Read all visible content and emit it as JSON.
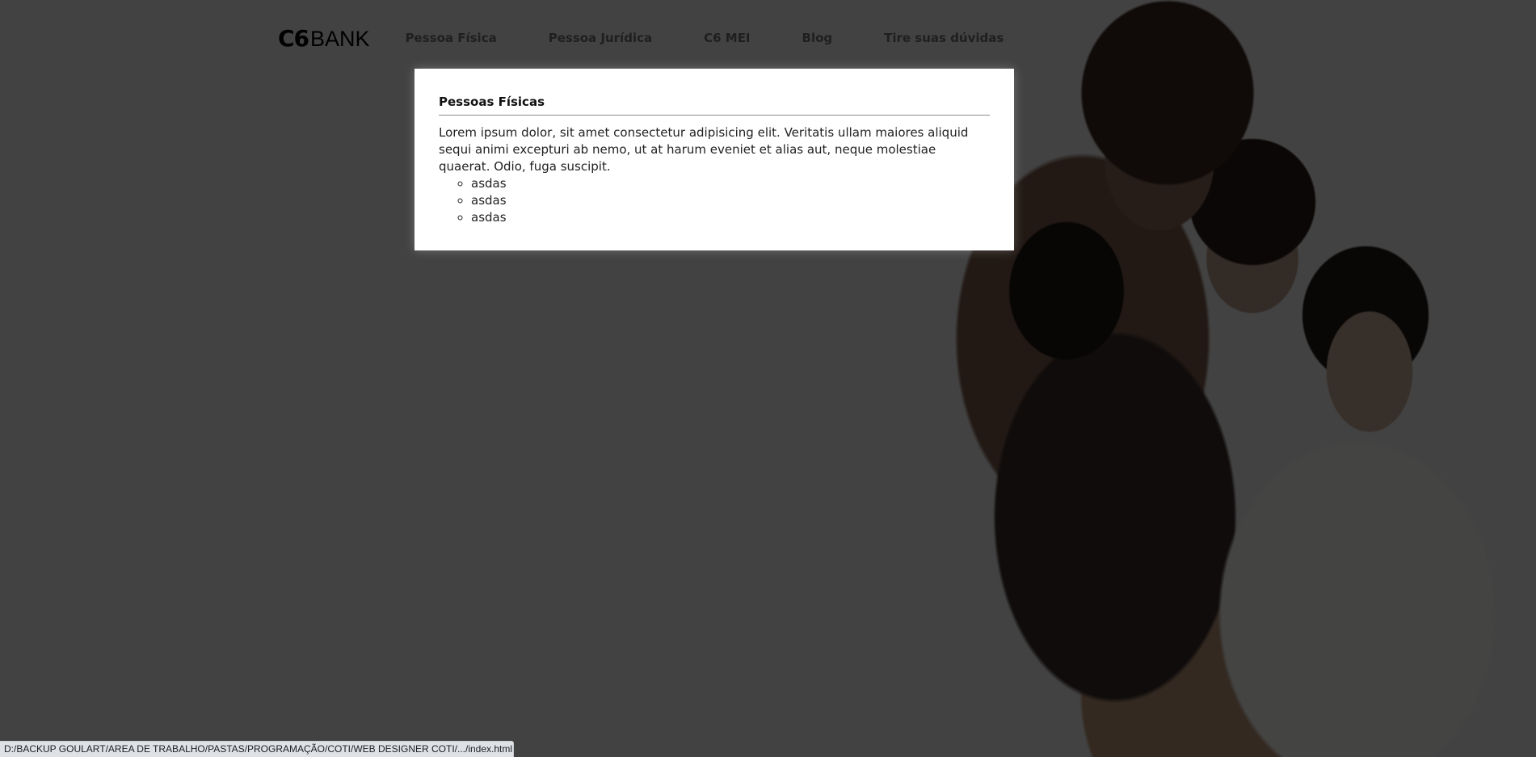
{
  "logo": {
    "c6": "C6",
    "bank": "BANK"
  },
  "nav": {
    "items": [
      {
        "label": "Pessoa Física"
      },
      {
        "label": "Pessoa Jurídica"
      },
      {
        "label": "C6 MEI"
      },
      {
        "label": "Blog"
      },
      {
        "label": "Tire suas dúvidas"
      }
    ]
  },
  "card": {
    "title": "Pessoas Físicas",
    "text": "Lorem ipsum dolor, sit amet consectetur adipisicing elit. Veritatis ullam maiores aliquid sequi animi excepturi ab nemo, ut at harum eveniet et alias aut, neque molestiae quaerat. Odio, fuga suscipit.",
    "list": [
      "asdas",
      "asdas",
      "asdas"
    ]
  },
  "status_bar": {
    "url": "D:/BACKUP GOULART/AREA DE TRABALHO/PASTAS/PROGRAMAÇÃO/COTI/WEB DESIGNER COTI/.../index.html"
  }
}
